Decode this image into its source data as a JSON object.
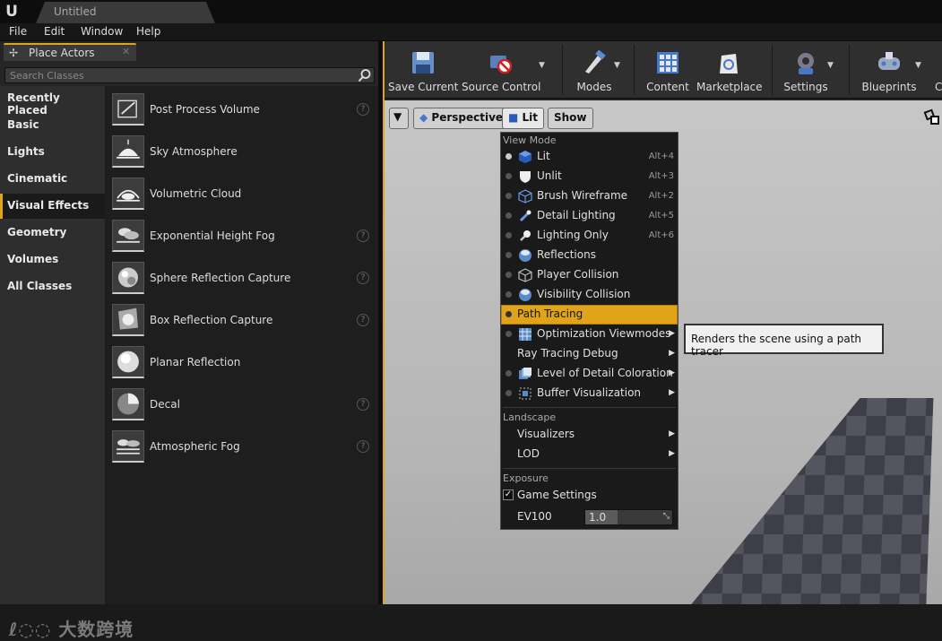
{
  "titlebar": {
    "logo": "U",
    "doc_tab": "Untitled"
  },
  "menubar": [
    "File",
    "Edit",
    "Window",
    "Help"
  ],
  "panel": {
    "tab_label": "Place Actors",
    "search_placeholder": "Search Classes",
    "categories": [
      "Recently Placed",
      "Basic",
      "Lights",
      "Cinematic",
      "Visual Effects",
      "Geometry",
      "Volumes",
      "All Classes"
    ],
    "active_category": "Visual Effects",
    "actors": [
      {
        "label": "Post Process Volume",
        "help": true,
        "icon": "post-process-volume-icon"
      },
      {
        "label": "Sky Atmosphere",
        "help": false,
        "icon": "sky-atmosphere-icon"
      },
      {
        "label": "Volumetric Cloud",
        "help": false,
        "icon": "volumetric-cloud-icon"
      },
      {
        "label": "Exponential Height Fog",
        "help": true,
        "icon": "fog-icon"
      },
      {
        "label": "Sphere Reflection Capture",
        "help": true,
        "icon": "sphere-reflection-icon"
      },
      {
        "label": "Box Reflection Capture",
        "help": true,
        "icon": "box-reflection-icon"
      },
      {
        "label": "Planar Reflection",
        "help": false,
        "icon": "planar-reflection-icon"
      },
      {
        "label": "Decal",
        "help": true,
        "icon": "decal-icon"
      },
      {
        "label": "Atmospheric Fog",
        "help": true,
        "icon": "atmospheric-fog-icon"
      }
    ],
    "help_glyph": "?"
  },
  "watermark": "大数跨境",
  "toolbar": {
    "buttons": [
      "Save Current",
      "Source Control",
      "Modes",
      "Content",
      "Marketplace",
      "Settings",
      "Blueprints",
      "C"
    ]
  },
  "viewport": {
    "perspective_label": "Perspective",
    "lit_label": "Lit",
    "show_label": "Show"
  },
  "view_menu": {
    "section_view_mode": "View Mode",
    "items": [
      {
        "label": "Lit",
        "shortcut": "Alt+4",
        "icon": "cube-icon",
        "selected": true
      },
      {
        "label": "Unlit",
        "shortcut": "Alt+3",
        "icon": "shield-icon",
        "selected": false
      },
      {
        "label": "Brush Wireframe",
        "shortcut": "Alt+2",
        "icon": "wireframe-cube-icon",
        "selected": false
      },
      {
        "label": "Detail Lighting",
        "shortcut": "Alt+5",
        "icon": "detail-lighting-icon",
        "selected": false
      },
      {
        "label": "Lighting Only",
        "shortcut": "Alt+6",
        "icon": "lighting-only-icon",
        "selected": false
      },
      {
        "label": "Reflections",
        "shortcut": "",
        "icon": "reflection-sphere-icon",
        "selected": false
      },
      {
        "label": "Player Collision",
        "shortcut": "",
        "icon": "collision-cube-icon",
        "selected": false
      },
      {
        "label": "Visibility Collision",
        "shortcut": "",
        "icon": "visibility-sphere-icon",
        "selected": false
      }
    ],
    "path_tracing": "Path Tracing",
    "optimization": "Optimization Viewmodes",
    "ray_tracing": "Ray Tracing Debug",
    "lod_coloration": "Level of Detail Coloration",
    "buffer_vis": "Buffer Visualization",
    "section_landscape": "Landscape",
    "visualizers": "Visualizers",
    "lod": "LOD",
    "section_exposure": "Exposure",
    "game_settings": "Game Settings",
    "game_settings_checked": true,
    "ev100_label": "EV100",
    "ev100_value": "1.0"
  },
  "tooltip": "Renders the scene using a path tracer",
  "colors": {
    "accent": "#e0a41a",
    "highlight_text": "#111111"
  }
}
